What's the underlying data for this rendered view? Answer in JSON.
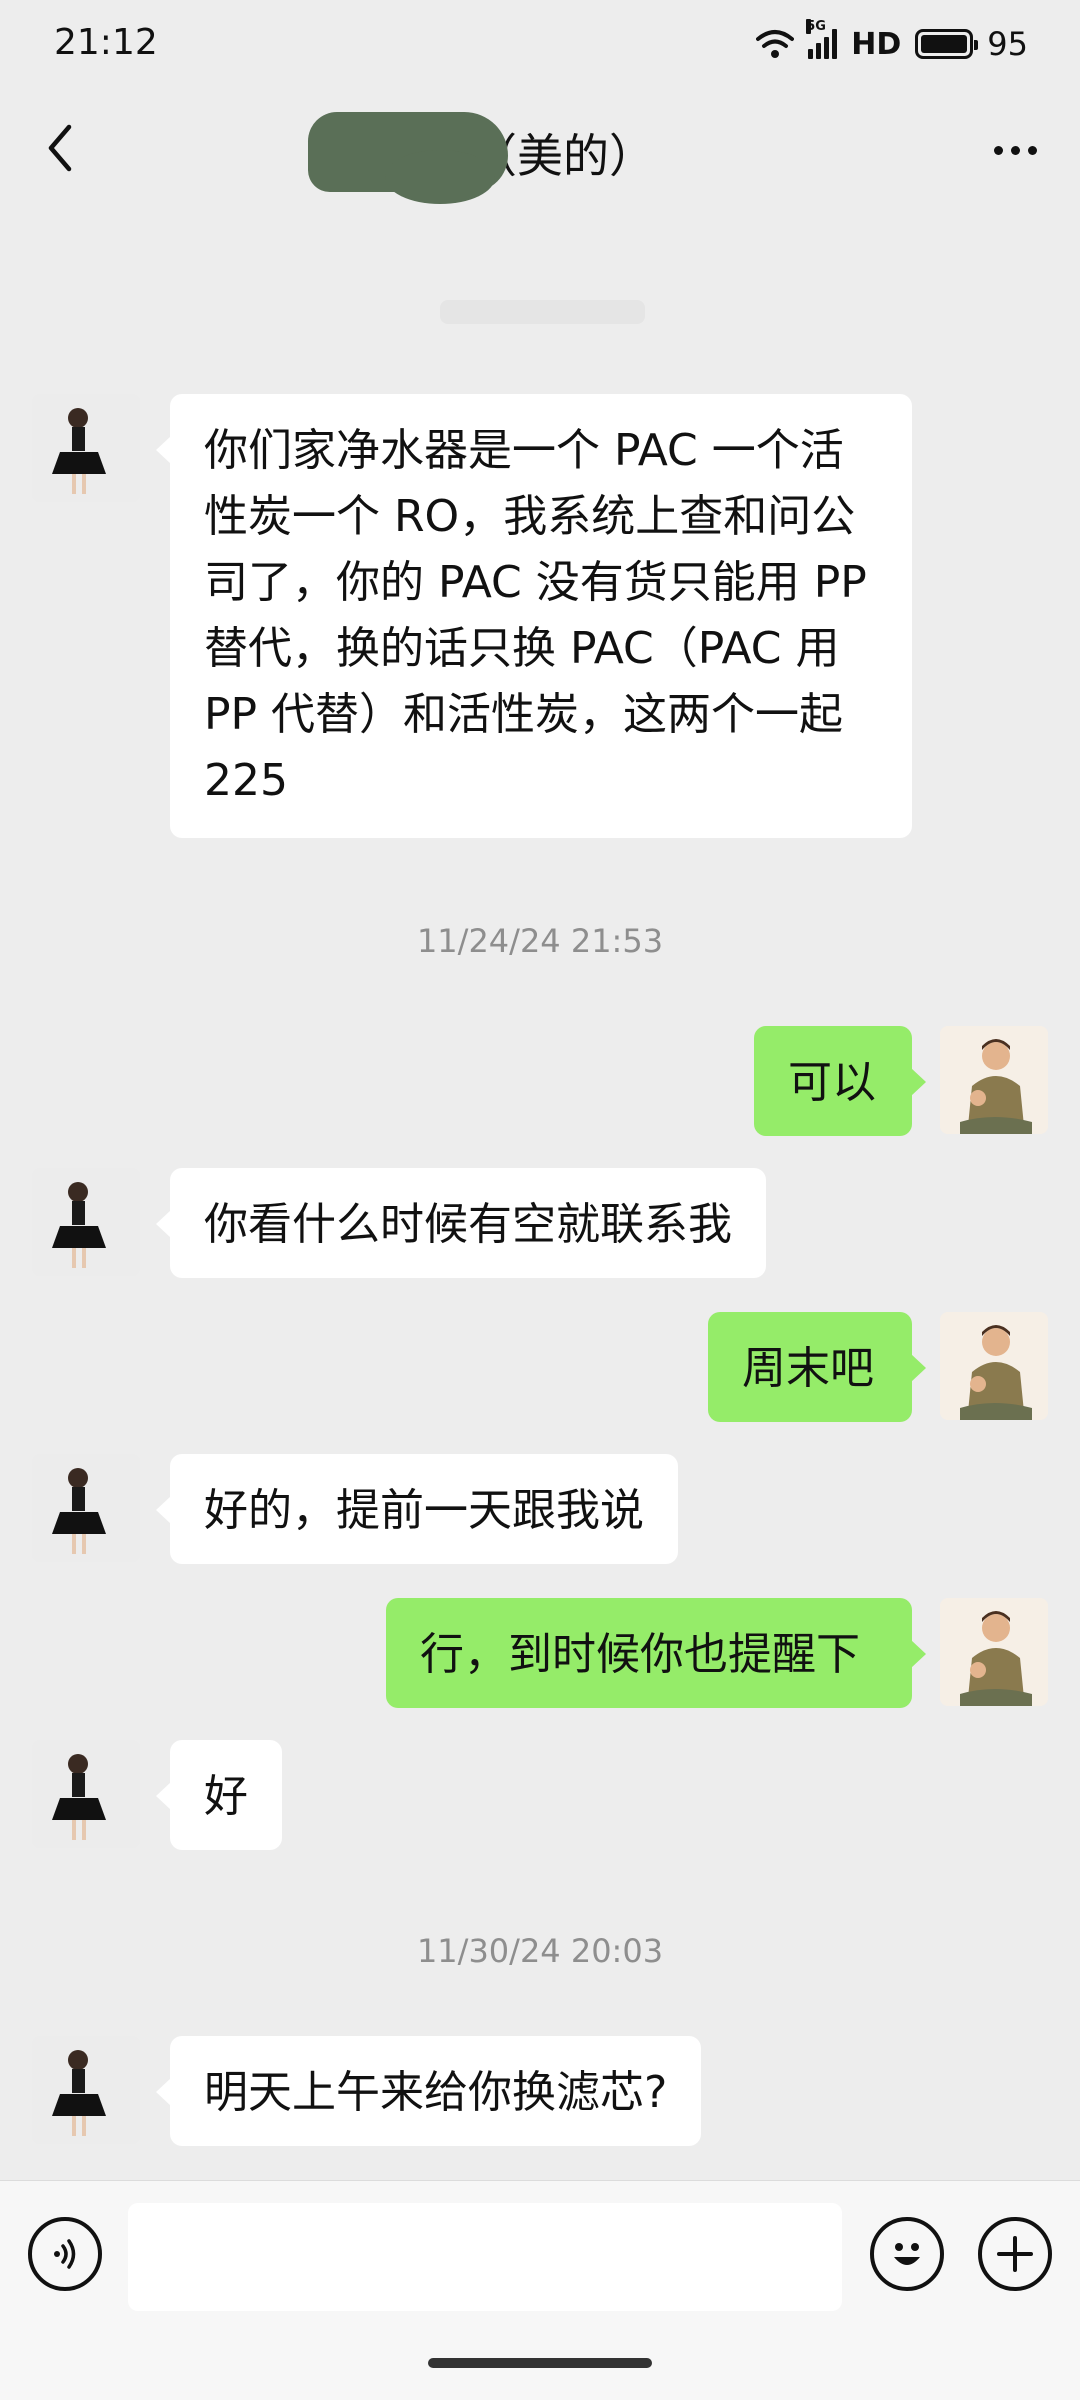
{
  "status_bar": {
    "time": "21:12",
    "network": "5G",
    "hd": "HD",
    "battery": "95"
  },
  "header": {
    "title": "王（美的）"
  },
  "timestamps": [
    "11/24/24 21:53",
    "11/30/24 20:03"
  ],
  "messages": [
    {
      "side": "in",
      "text": "你们家净水器是一个 PAC 一个活性炭一个 RO，我系统上查和问公司了，你的 PAC 没有货只能用 PP 替代，换的话只换 PAC（PAC 用PP 代替）和活性炭，这两个一起225"
    },
    {
      "side": "out",
      "text": "可以"
    },
    {
      "side": "in",
      "text": "你看什么时候有空就联系我"
    },
    {
      "side": "out",
      "text": "周末吧"
    },
    {
      "side": "in",
      "text": "好的，提前一天跟我说"
    },
    {
      "side": "out",
      "text": "行，到时候你也提醒下"
    },
    {
      "side": "in",
      "text": "好"
    },
    {
      "side": "in",
      "text": "明天上午来给你换滤芯?"
    }
  ],
  "input": {
    "value": "",
    "placeholder": ""
  },
  "icons": {
    "back": "chevron-left-icon",
    "more": "more-dots-icon",
    "voice": "voice-icon",
    "emoji": "emoji-icon",
    "add": "add-icon"
  },
  "colors": {
    "background": "#ededed",
    "incoming_bubble": "#ffffff",
    "outgoing_bubble": "#95ec69"
  }
}
